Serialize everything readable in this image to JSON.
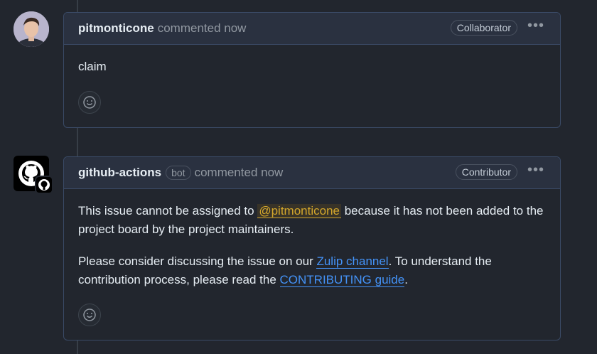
{
  "comments": [
    {
      "author": "pitmonticone",
      "meta": "commented now",
      "role": "Collaborator",
      "more": "•••",
      "body": "claim"
    },
    {
      "author": "github-actions",
      "bot_label": "bot",
      "meta": "commented now",
      "role": "Contributor",
      "more": "•••",
      "para1_before": "This issue cannot be assigned to ",
      "mention": "@pitmonticone",
      "para1_after": " because it has not been added to the project board by the project maintainers.",
      "para2_before": "Please consider discussing the issue on our ",
      "link1": "Zulip channel",
      "para2_mid": ". To understand the contribution process, please read the ",
      "link2": "CONTRIBUTING guide",
      "para2_after": "."
    }
  ],
  "icons": {
    "avatar_user": "user-avatar",
    "avatar_bot": "github-octocat-icon",
    "reaction": "smiley-icon"
  },
  "colors": {
    "background": "#22262e",
    "header": "#2a3140",
    "border": "#3a4a66",
    "link": "#4493f8",
    "mention": "#d4a72c"
  }
}
